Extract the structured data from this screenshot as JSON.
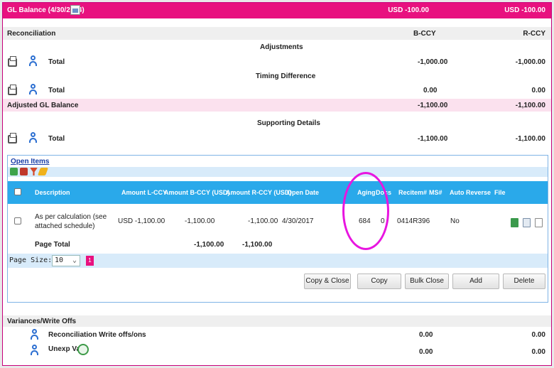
{
  "header": {
    "title": "GL Balance (4/30/2014)",
    "left_value": "USD -100.00",
    "right_value": "USD -100.00"
  },
  "recon": {
    "label": "Reconciliation",
    "bccy": "B-CCY",
    "rccy": "R-CCY"
  },
  "adjustments": {
    "label": "Adjustments",
    "total_label": "Total",
    "bccy": "-1,000.00",
    "rccy": "-1,000.00"
  },
  "timing": {
    "label": "Timing Difference",
    "total_label": "Total",
    "bccy": "0.00",
    "rccy": "0.00"
  },
  "adjusted": {
    "label": "Adjusted GL Balance",
    "bccy": "-1,100.00",
    "rccy": "-1,100.00"
  },
  "supporting": {
    "label": "Supporting Details",
    "total_label": "Total",
    "bccy": "-1,100.00",
    "rccy": "-1,100.00"
  },
  "open_items": {
    "link": "Open Items",
    "columns": {
      "description": "Description",
      "amount_lccy": "Amount L-CCY",
      "amount_bccy": "Amount B-CCY (USD)",
      "amount_rccy": "Amount R-CCY (USD)",
      "open_date": "Open Date",
      "aging": "Aging",
      "docs": "Docs",
      "recitem": "Recitem#",
      "ms": "MS#",
      "auto_reverse": "Auto Reverse",
      "file": "File"
    },
    "row": {
      "description_line1": "As per calculation (see",
      "description_line2": "attached schedule)",
      "amount_lccy": "USD -1,100.00",
      "amount_bccy": "-1,100.00",
      "amount_rccy": "-1,100.00",
      "open_date": "4/30/2017",
      "aging": "684",
      "docs": "0",
      "recitem": "0414R396",
      "auto_reverse": "No"
    },
    "page_total": {
      "label": "Page Total",
      "bccy": "-1,100.00",
      "rccy": "-1,100.00"
    },
    "pager": {
      "label": "Page Size:",
      "size": "10",
      "current_page": "1"
    },
    "buttons": {
      "copy_close": "Copy & Close",
      "copy": "Copy",
      "bulk_close": "Bulk Close",
      "add": "Add",
      "delete": "Delete"
    }
  },
  "variances": {
    "label": "Variances/Write Offs",
    "rows": [
      {
        "label": "Reconciliation Write offs/ons",
        "bccy": "0.00",
        "rccy": "0.00"
      },
      {
        "label": "Unexp Var",
        "bccy": "0.00",
        "rccy": "0.00"
      }
    ]
  },
  "colors": {
    "header": "#e8117f",
    "table_header": "#2aa9ea",
    "highlight_circle": "#e815e0"
  },
  "icons": [
    "calendar-icon",
    "print-icon",
    "person-icon",
    "add-icon",
    "export-icon",
    "filter-icon",
    "edit-icon",
    "refresh-icon"
  ]
}
